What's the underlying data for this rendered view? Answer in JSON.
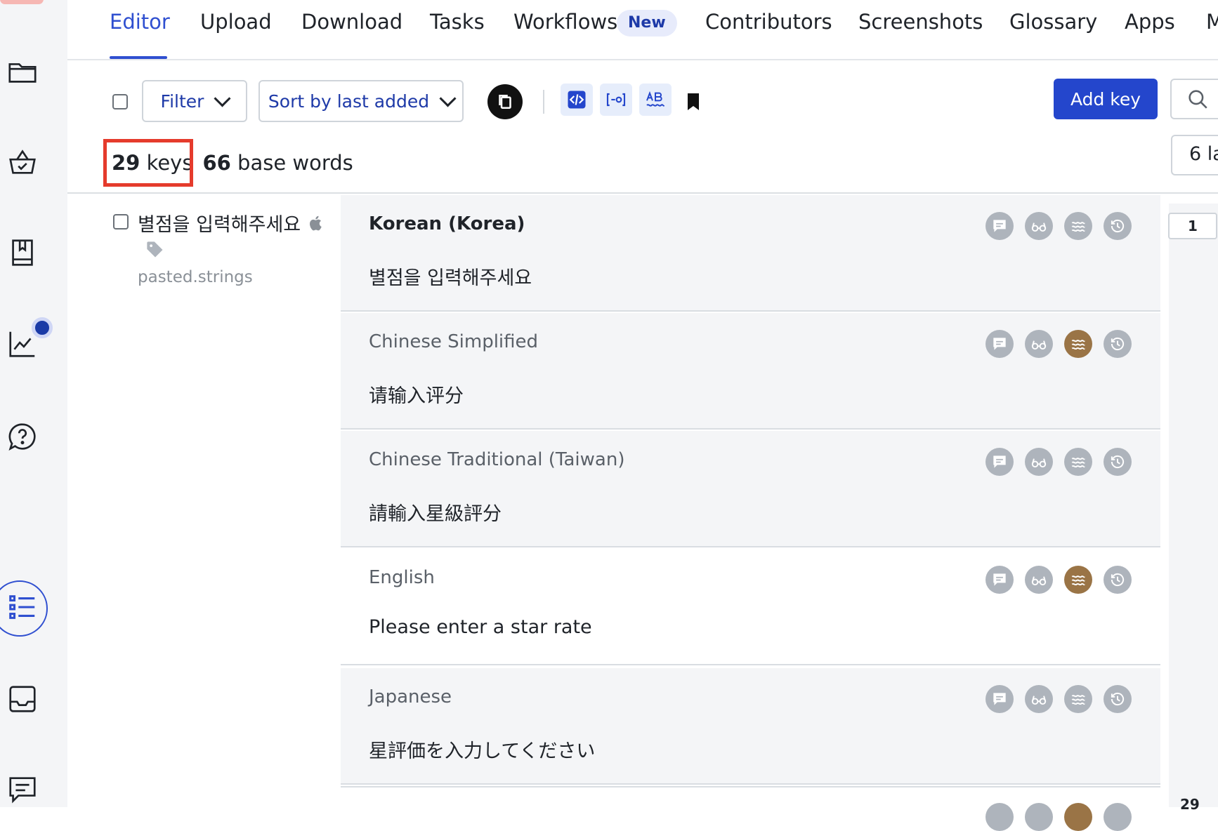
{
  "nav": {
    "tabs": [
      {
        "label": "Editor",
        "active": true
      },
      {
        "label": "Upload"
      },
      {
        "label": "Download"
      },
      {
        "label": "Tasks"
      },
      {
        "label": "Workflows"
      },
      {
        "label": "Contributors"
      },
      {
        "label": "Screenshots"
      },
      {
        "label": "Glossary"
      },
      {
        "label": "Apps"
      },
      {
        "label": "M"
      }
    ],
    "new_badge": "New"
  },
  "rail": {
    "icons": [
      "folder-icon",
      "basket-check-icon",
      "book-icon",
      "chart-icon",
      "help-icon",
      "list-icon",
      "inbox-icon",
      "chat-icon"
    ],
    "active": "list-icon"
  },
  "toolbar": {
    "filter_label": "Filter",
    "sort_label": "Sort by last added",
    "add_key_label": "Add key",
    "tool_icons": [
      "code-icon",
      "placeholder-icon",
      "spellcheck-icon",
      "bookmark-icon"
    ]
  },
  "counts": {
    "keys_number": "29",
    "keys_label": "keys",
    "words_number": "66",
    "words_label": "base words",
    "languages_partial": "6 la"
  },
  "key": {
    "name": "별점을 입력해주세요",
    "platform_icon": "apple-icon",
    "tag_icon": "tag-icon",
    "file": "pasted.strings"
  },
  "translations": [
    {
      "language": "Korean (Korea)",
      "value": "별점을 입력해주세요",
      "base": true,
      "tm_highlight": false
    },
    {
      "language": "Chinese Simplified",
      "value": "请输入评分",
      "base": false,
      "tm_highlight": true
    },
    {
      "language": "Chinese Traditional (Taiwan)",
      "value": "請輸入星級評分",
      "base": false,
      "tm_highlight": false
    },
    {
      "language": "English",
      "value": "Please enter a star rate",
      "base": false,
      "tm_highlight": true
    },
    {
      "language": "Japanese",
      "value": "星評価を入力してください",
      "base": false,
      "tm_highlight": false
    }
  ],
  "row_icons": [
    "comment-icon",
    "glasses-icon",
    "tm-waves-icon",
    "history-icon"
  ],
  "pagination": {
    "current": "1",
    "bottom": "29"
  },
  "colors": {
    "accent": "#2446cc",
    "highlight": "#e53b2c",
    "tm_brown": "#9a7446"
  }
}
